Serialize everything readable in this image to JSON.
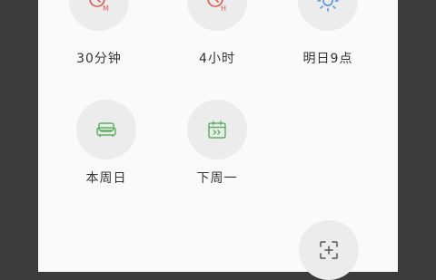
{
  "options": {
    "thirty_min": {
      "label": "30分钟",
      "icon": "clock-m-icon",
      "color": "#e05a4f"
    },
    "four_hours": {
      "label": "4小时",
      "icon": "clock-h-icon",
      "color": "#e05a4f"
    },
    "tomorrow_9": {
      "label": "明日9点",
      "icon": "sun-icon",
      "color": "#4a8ee8"
    },
    "this_sunday": {
      "label": "本周日",
      "icon": "sofa-icon",
      "color": "#5fb063"
    },
    "next_monday": {
      "label": "下周一",
      "icon": "calendar-forward-icon",
      "color": "#5fb063"
    }
  },
  "custom": {
    "icon": "custom-select-icon",
    "color": "#555555"
  }
}
